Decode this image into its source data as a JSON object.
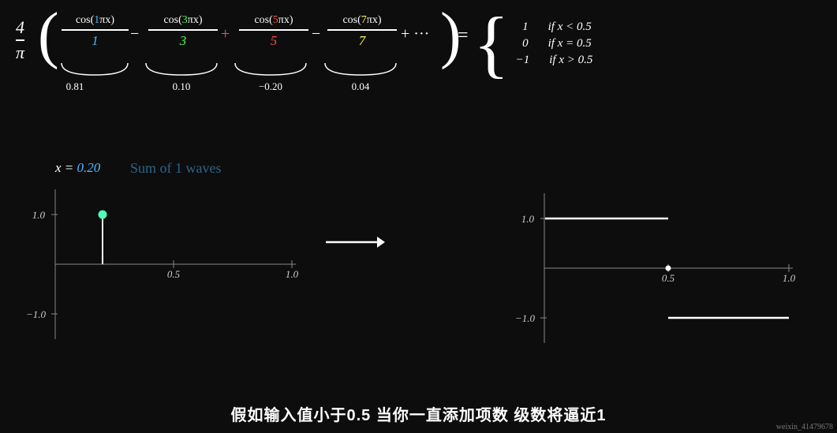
{
  "formula": {
    "prefix_num": "4",
    "prefix_den": "π",
    "terms": [
      {
        "num_text": "cos(1πx)",
        "num_color_start": 4,
        "num_color_end": 5,
        "den": "1",
        "den_color": "#4db8ff",
        "operator": "",
        "brace_width": 90,
        "brace_label": "0.81"
      },
      {
        "num_text": "cos(3πx)",
        "num_color_start": 4,
        "num_color_end": 5,
        "den": "3",
        "den_color": "#4dff4d",
        "operator": "−",
        "brace_width": 90,
        "brace_label": "0.10"
      },
      {
        "num_text": "cos(5πx)",
        "num_color_start": 4,
        "num_color_end": 5,
        "den": "5",
        "den_color": "#ff4d4d",
        "operator": "+",
        "brace_width": 90,
        "brace_label": "−0.20"
      },
      {
        "num_text": "cos(7πx)",
        "num_color_start": 4,
        "num_color_end": 5,
        "den": "7",
        "den_color": "#ffff4d",
        "operator": "−",
        "brace_width": 90,
        "brace_label": "0.04"
      }
    ],
    "piecewise": [
      {
        "value": "1",
        "condition": "if x < 0.5"
      },
      {
        "value": "0",
        "condition": "if x = 0.5"
      },
      {
        "value": "−1",
        "condition": "if x > 0.5"
      }
    ]
  },
  "left_graph": {
    "x_label": "x =",
    "x_value": "0.20",
    "subtitle": "Sum of  1  waves",
    "y_ticks": [
      "1.0",
      "−1.0"
    ],
    "x_ticks": [
      "0.5",
      "1.0"
    ]
  },
  "right_graph": {
    "y_ticks": [
      "1.0",
      "−1.0"
    ],
    "x_ticks": [
      "0.5",
      "1.0"
    ]
  },
  "bottom_text": "假如输入值小于0.5   当你一直添加项数   级数将逼近1",
  "watermark": "weixin_41479678"
}
